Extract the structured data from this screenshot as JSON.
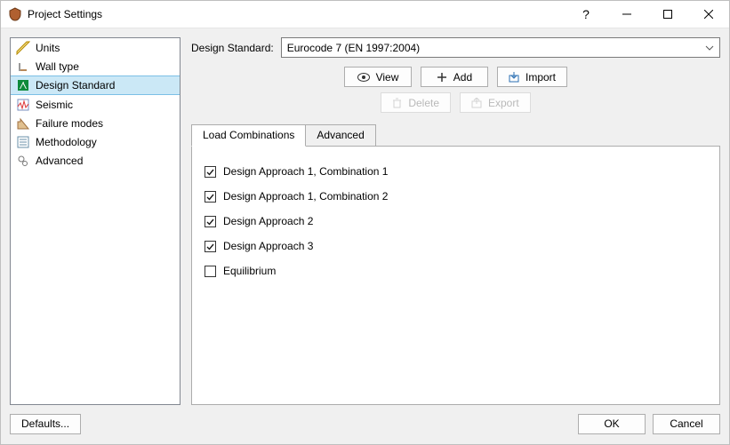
{
  "window": {
    "title": "Project Settings"
  },
  "nav": {
    "items": [
      {
        "label": "Units"
      },
      {
        "label": "Wall type"
      },
      {
        "label": "Design Standard"
      },
      {
        "label": "Seismic"
      },
      {
        "label": "Failure modes"
      },
      {
        "label": "Methodology"
      },
      {
        "label": "Advanced"
      }
    ],
    "selected_index": 2
  },
  "form": {
    "standard_label": "Design Standard:",
    "standard_value": "Eurocode 7 (EN 1997:2004)"
  },
  "toolbar": {
    "view": "View",
    "add": "Add",
    "import": "Import",
    "delete": "Delete",
    "export": "Export"
  },
  "tabs": {
    "items": [
      {
        "label": "Load Combinations"
      },
      {
        "label": "Advanced"
      }
    ],
    "active_index": 0
  },
  "combinations": [
    {
      "label": "Design Approach 1, Combination 1",
      "checked": true
    },
    {
      "label": "Design Approach 1, Combination 2",
      "checked": true
    },
    {
      "label": "Design Approach 2",
      "checked": true
    },
    {
      "label": "Design Approach 3",
      "checked": true
    },
    {
      "label": "Equilibrium",
      "checked": false
    }
  ],
  "footer": {
    "defaults": "Defaults...",
    "ok": "OK",
    "cancel": "Cancel"
  }
}
